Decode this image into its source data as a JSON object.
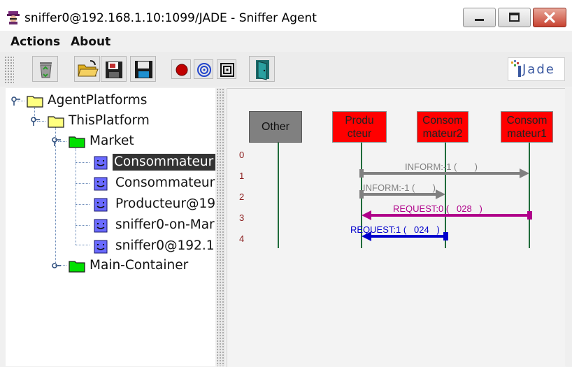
{
  "window": {
    "title": "sniffer0@192.168.1.10:1099/JADE - Sniffer Agent"
  },
  "menu": {
    "items": [
      "Actions",
      "About"
    ]
  },
  "toolbar": {
    "buttons": [
      {
        "name": "recycle-bin-icon"
      },
      {
        "name": "open-folder-icon"
      },
      {
        "name": "save-snapshot-icon"
      },
      {
        "name": "floppy-disk-icon"
      },
      {
        "name": "record-red-dot-icon"
      },
      {
        "name": "spiral-blue-icon"
      },
      {
        "name": "spiral-black-icon"
      },
      {
        "name": "exit-door-icon"
      }
    ],
    "logo_text": "Jade"
  },
  "tree": {
    "root": "AgentPlatforms",
    "platform": "ThisPlatform",
    "container1": "Market",
    "agents": [
      "Consommateur",
      "Consommateur",
      "Producteur@19",
      "sniffer0-on-Mar",
      "sniffer0@192.1"
    ],
    "container2": "Main-Container"
  },
  "sequence": {
    "agents": [
      {
        "label": "Other",
        "line2": "",
        "color": "#808080"
      },
      {
        "label": "Produ",
        "line2": "cteur",
        "color": "#ff0000"
      },
      {
        "label": "Consom",
        "line2": "mateur2",
        "color": "#ff0000"
      },
      {
        "label": "Consom",
        "line2": "mateur1",
        "color": "#ff0000"
      }
    ],
    "rows": [
      "0",
      "1",
      "2",
      "3",
      "4"
    ],
    "messages": [
      {
        "label": "INFORM:-1 (       )",
        "color": "#808080"
      },
      {
        "label": "INFORM:-1 (       )",
        "color": "#808080"
      },
      {
        "label": "REQUEST:0 (   028   )",
        "color": "#b0008a"
      },
      {
        "label": "REQUEST:1 (   024   )",
        "color": "#0000cc"
      }
    ]
  }
}
